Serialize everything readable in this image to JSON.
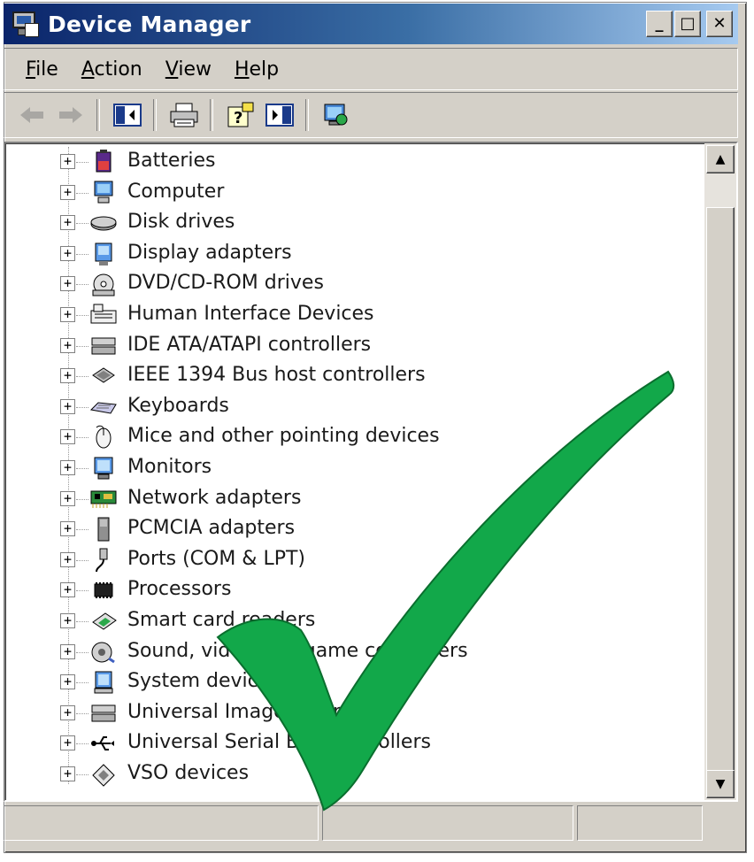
{
  "window": {
    "title": "Device Manager"
  },
  "title_controls": {
    "minimize": "_",
    "maximize": "□",
    "close": "✕"
  },
  "menu": [
    {
      "key": "F",
      "rest": "ile"
    },
    {
      "key": "A",
      "rest": "ction"
    },
    {
      "key": "V",
      "rest": "iew"
    },
    {
      "key": "H",
      "rest": "elp"
    }
  ],
  "toolbar_icons": [
    "back-arrow-icon",
    "forward-arrow-icon",
    "show-hide-tree-icon",
    "print-icon",
    "help-icon",
    "properties-icon",
    "scan-hardware-icon"
  ],
  "tree": {
    "expander_symbol": "+",
    "items": [
      {
        "label": "Batteries",
        "icon": "battery-icon"
      },
      {
        "label": "Computer",
        "icon": "computer-icon"
      },
      {
        "label": "Disk drives",
        "icon": "disk-drive-icon"
      },
      {
        "label": "Display adapters",
        "icon": "display-adapter-icon"
      },
      {
        "label": "DVD/CD-ROM drives",
        "icon": "dvd-drive-icon"
      },
      {
        "label": "Human Interface Devices",
        "icon": "hid-icon"
      },
      {
        "label": "IDE ATA/ATAPI controllers",
        "icon": "ide-controller-icon"
      },
      {
        "label": "IEEE 1394 Bus host controllers",
        "icon": "ieee1394-icon"
      },
      {
        "label": "Keyboards",
        "icon": "keyboard-icon"
      },
      {
        "label": "Mice and other pointing devices",
        "icon": "mouse-icon"
      },
      {
        "label": "Monitors",
        "icon": "monitor-icon"
      },
      {
        "label": "Network adapters",
        "icon": "network-adapter-icon"
      },
      {
        "label": "PCMCIA adapters",
        "icon": "pcmcia-icon"
      },
      {
        "label": "Ports (COM & LPT)",
        "icon": "port-icon"
      },
      {
        "label": "Processors",
        "icon": "processor-icon"
      },
      {
        "label": "Smart card readers",
        "icon": "smart-card-icon"
      },
      {
        "label": "Sound, video and game controllers",
        "icon": "sound-icon"
      },
      {
        "label": "System devices",
        "icon": "system-device-icon"
      },
      {
        "label": "Universal Image Mounter",
        "icon": "image-mounter-icon"
      },
      {
        "label": "Universal Serial Bus controllers",
        "icon": "usb-icon"
      },
      {
        "label": "VSO devices",
        "icon": "vso-device-icon"
      }
    ]
  },
  "scrollbar": {
    "up": "▲",
    "down": "▼"
  },
  "colors": {
    "title_gradient_start": "#0a246a",
    "title_gradient_end": "#a6caf0",
    "window_face": "#d4d0c8",
    "checkmark_fill": "#12a84a",
    "checkmark_edge": "#0a6e2e"
  }
}
